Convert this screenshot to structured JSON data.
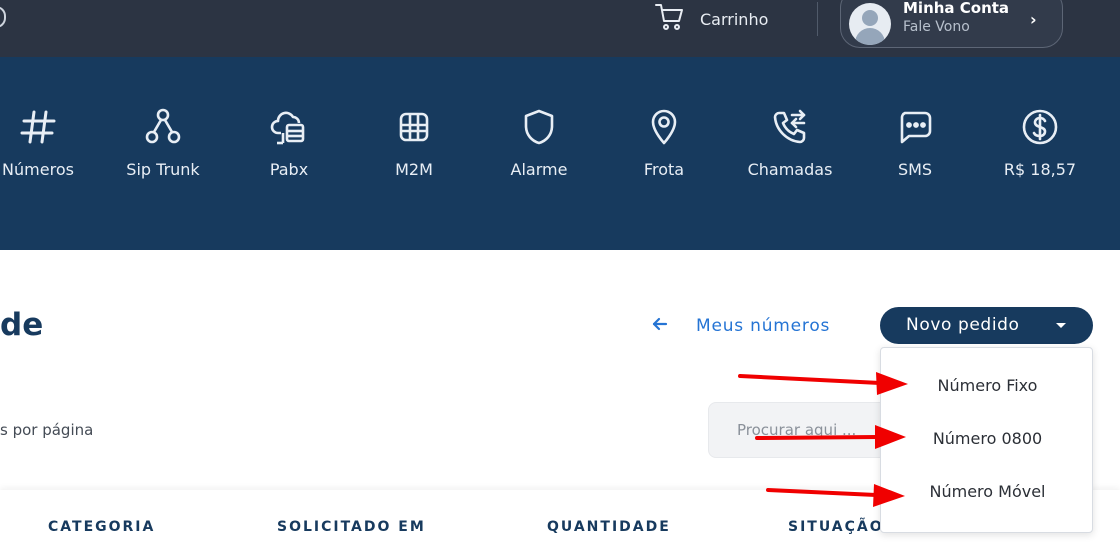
{
  "header": {
    "cart_label": "Carrinho",
    "account_name": "Minha Conta",
    "account_sub": "Fale Vono"
  },
  "nav": {
    "items": [
      {
        "label": "Números",
        "icon": "hash-icon"
      },
      {
        "label": "Sip Trunk",
        "icon": "sip-trunk-icon"
      },
      {
        "label": "Pabx",
        "icon": "pabx-icon"
      },
      {
        "label": "M2M",
        "icon": "sim-chip-icon"
      },
      {
        "label": "Alarme",
        "icon": "shield-icon"
      },
      {
        "label": "Frota",
        "icon": "location-pin-icon"
      },
      {
        "label": "Chamadas",
        "icon": "phone-transfer-icon"
      },
      {
        "label": "SMS",
        "icon": "chat-bubble-icon"
      },
      {
        "label": "R$ 18,57",
        "icon": "dollar-coin-icon"
      }
    ]
  },
  "main": {
    "title_fragment": "de",
    "back_link": "Meus números",
    "new_order_label": "Novo pedido",
    "per_page_label": "s por página",
    "search_placeholder": "Procurar aqui ..."
  },
  "table": {
    "headers": [
      "CATEGORIA",
      "SOLICITADO EM",
      "QUANTIDADE",
      "SITUAÇÃO"
    ]
  },
  "dropdown": {
    "items": [
      "Número Fixo",
      "Número 0800",
      "Número Móvel"
    ]
  },
  "colors": {
    "topbar": "#2c3443",
    "nav_band": "#173a5e",
    "link": "#2574d4",
    "annotation_arrow": "#f00000"
  }
}
